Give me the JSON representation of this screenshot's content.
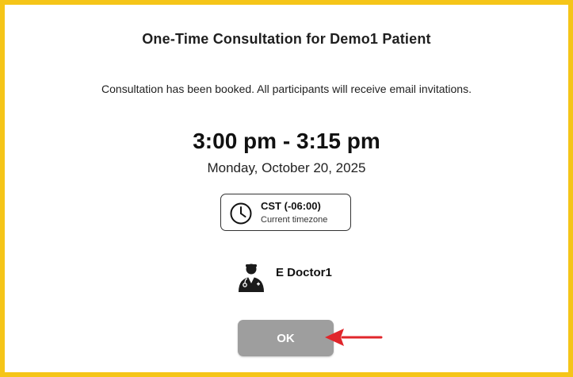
{
  "dialog": {
    "title": "One-Time Consultation for Demo1 Patient",
    "message": "Consultation has been booked. All participants will receive email invitations.",
    "time_range": "3:00 pm - 3:15 pm",
    "date": "Monday, October 20, 2025",
    "timezone": {
      "code": "CST (-06:00)",
      "label": "Current timezone",
      "icon": "clock-icon"
    },
    "doctor": {
      "name": "E Doctor1",
      "icon": "doctor-avatar-icon"
    },
    "ok_button": {
      "label": "OK",
      "color": "#9e9e9e"
    }
  },
  "annotation": {
    "icon": "red-arrow-icon",
    "color": "#e0262b"
  },
  "frame_color": "#f5c518"
}
